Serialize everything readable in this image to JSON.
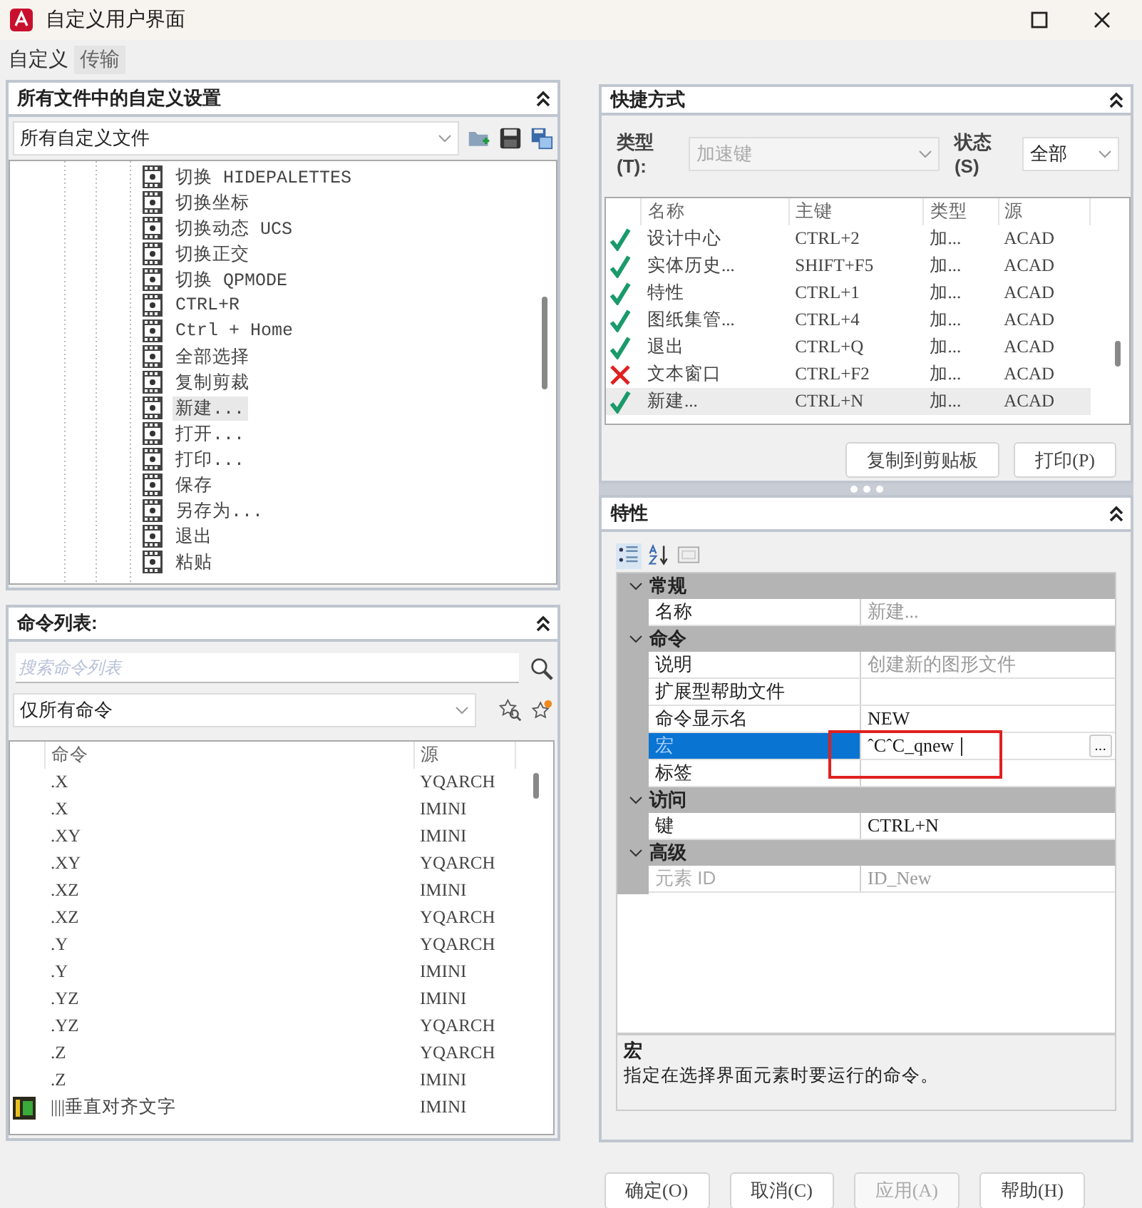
{
  "window": {
    "title": "自定义用户界面"
  },
  "tabs": [
    {
      "label": "自定义",
      "selected": true
    },
    {
      "label": "传输",
      "selected": false
    }
  ],
  "customizations": {
    "title": "所有文件中的自定义设置",
    "expanded": true,
    "file_select": "所有自定义文件",
    "items": [
      {
        "label": "切换 HIDEPALETTES",
        "selected": false
      },
      {
        "label": "切换坐标",
        "selected": false
      },
      {
        "label": "切换动态 UCS",
        "selected": false
      },
      {
        "label": "切换正交",
        "selected": false
      },
      {
        "label": "切换 QPMODE",
        "selected": false
      },
      {
        "label": "CTRL+R",
        "selected": false
      },
      {
        "label": "Ctrl + Home",
        "selected": false
      },
      {
        "label": "全部选择",
        "selected": false
      },
      {
        "label": "复制剪裁",
        "selected": false
      },
      {
        "label": "新建...",
        "selected": true
      },
      {
        "label": "打开...",
        "selected": false
      },
      {
        "label": "打印...",
        "selected": false
      },
      {
        "label": "保存",
        "selected": false
      },
      {
        "label": "另存为...",
        "selected": false
      },
      {
        "label": "退出",
        "selected": false
      },
      {
        "label": "粘贴",
        "selected": false
      }
    ]
  },
  "command_list": {
    "title": "命令列表:",
    "expanded": true,
    "search": {
      "placeholder": "搜索命令列表"
    },
    "filter": "仅所有命令",
    "columns": [
      "命令",
      "源"
    ],
    "rows": [
      {
        "kind": "plain",
        "command": ".X",
        "source": "YQARCH"
      },
      {
        "kind": "plain",
        "command": ".X",
        "source": "IMINI"
      },
      {
        "kind": "plain",
        "command": ".XY",
        "source": "IMINI"
      },
      {
        "kind": "plain",
        "command": ".XY",
        "source": "YQARCH"
      },
      {
        "kind": "plain",
        "command": ".XZ",
        "source": "IMINI"
      },
      {
        "kind": "plain",
        "command": ".XZ",
        "source": "YQARCH"
      },
      {
        "kind": "plain",
        "command": ".Y",
        "source": "YQARCH"
      },
      {
        "kind": "plain",
        "command": ".Y",
        "source": "IMINI"
      },
      {
        "kind": "plain",
        "command": ".YZ",
        "source": "IMINI"
      },
      {
        "kind": "plain",
        "command": ".YZ",
        "source": "YQARCH"
      },
      {
        "kind": "plain",
        "command": ".Z",
        "source": "YQARCH"
      },
      {
        "kind": "plain",
        "command": ".Z",
        "source": "IMINI"
      },
      {
        "kind": "icon",
        "command": "||||垂直对齐文字",
        "source": "IMINI"
      }
    ]
  },
  "shortcuts": {
    "title": "快捷方式",
    "expanded": true,
    "type_label": "类型(T):",
    "type_value": "加速键",
    "type_disabled": true,
    "status_label": "状态(S)",
    "status_value": "全部",
    "columns": [
      "名称",
      "主键",
      "类型",
      "源"
    ],
    "rows": [
      {
        "kind": "ok",
        "name": "设计中心",
        "key": "CTRL+2",
        "type": "加...",
        "source": "ACAD",
        "selected": false
      },
      {
        "kind": "ok",
        "name": "实体历史...",
        "key": "SHIFT+F5",
        "type": "加...",
        "source": "ACAD",
        "selected": false
      },
      {
        "kind": "ok",
        "name": "特性",
        "key": "CTRL+1",
        "type": "加...",
        "source": "ACAD",
        "selected": false
      },
      {
        "kind": "ok",
        "name": "图纸集管...",
        "key": "CTRL+4",
        "type": "加...",
        "source": "ACAD",
        "selected": false
      },
      {
        "kind": "ok",
        "name": "退出",
        "key": "CTRL+Q",
        "type": "加...",
        "source": "ACAD",
        "selected": false
      },
      {
        "kind": "error",
        "name": "文本窗口",
        "key": "CTRL+F2",
        "type": "加...",
        "source": "ACAD",
        "selected": false
      },
      {
        "kind": "ok",
        "name": "新建...",
        "key": "CTRL+N",
        "type": "加...",
        "source": "ACAD",
        "selected": true
      }
    ],
    "buttons": [
      "复制到剪贴板",
      "打印(P)"
    ]
  },
  "properties": {
    "title": "特性",
    "expanded": true,
    "categories": [
      {
        "label": "常规",
        "expanded": true,
        "rows": [
          {
            "name": "名称",
            "value": "新建...",
            "readonly": true,
            "selected": false
          }
        ]
      },
      {
        "label": "命令",
        "expanded": true,
        "rows": [
          {
            "name": "说明",
            "value": "创建新的图形文件",
            "readonly": true,
            "selected": false
          },
          {
            "name": "扩展型帮助文件",
            "selected": false
          },
          {
            "name": "命令显示名",
            "value": "NEW",
            "readonly": false,
            "selected": false
          },
          {
            "name": "宏",
            "value": "ˆCˆC_qnew",
            "readonly": false,
            "selected": true,
            "editing": true,
            "highlighted": true,
            "button": "..."
          },
          {
            "name": "标签",
            "selected": false
          }
        ]
      },
      {
        "label": "访问",
        "expanded": true,
        "rows": [
          {
            "name": "键",
            "value": "CTRL+N",
            "readonly": false,
            "selected": false
          }
        ]
      },
      {
        "label": "高级",
        "expanded": true,
        "rows": [
          {
            "name": "元素 ID",
            "value": "ID_New",
            "readonly": true,
            "name_disabled": true,
            "selected": false
          }
        ]
      }
    ],
    "help_title": "宏",
    "help_text": "指定在选择界面元素时要运行的命令。"
  },
  "buttons": [
    {
      "label": "确定(O)",
      "disabled": false
    },
    {
      "label": "取消(C)",
      "disabled": false
    },
    {
      "label": "应用(A)",
      "disabled": true
    },
    {
      "label": "帮助(H)",
      "disabled": false
    }
  ]
}
